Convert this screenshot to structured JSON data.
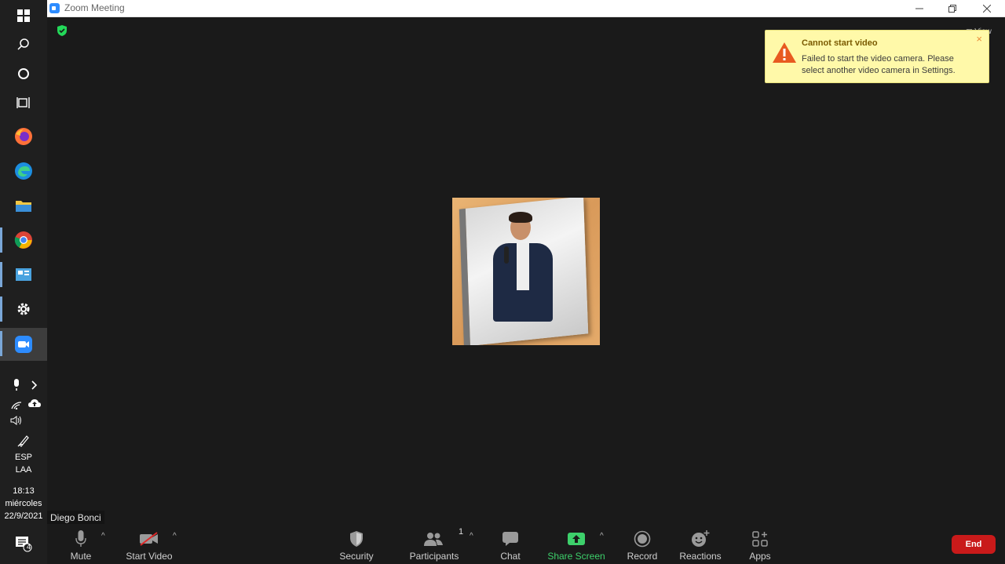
{
  "window": {
    "title": "Zoom Meeting"
  },
  "notification": {
    "title": "Cannot start video",
    "message": "Failed to start the video camera. Please select another video camera in Settings.",
    "close_glyph": "×"
  },
  "view_label": "View",
  "participant": {
    "name": "Diego Bonci"
  },
  "toolbar": {
    "mute": "Mute",
    "start_video": "Start Video",
    "security": "Security",
    "participants": "Participants",
    "participants_count": "1",
    "chat": "Chat",
    "share_screen": "Share Screen",
    "record": "Record",
    "reactions": "Reactions",
    "apps": "Apps",
    "end": "End"
  },
  "taskbar": {
    "language": "ESP",
    "layout": "LAA",
    "time": "18:13",
    "day": "miércoles",
    "date": "22/9/2021",
    "notification_count": "4"
  },
  "colors": {
    "share_green": "#3dd06b",
    "end_red": "#c91a1a",
    "toast_bg": "#fff9a9",
    "zoom_blue": "#2d8cff"
  }
}
